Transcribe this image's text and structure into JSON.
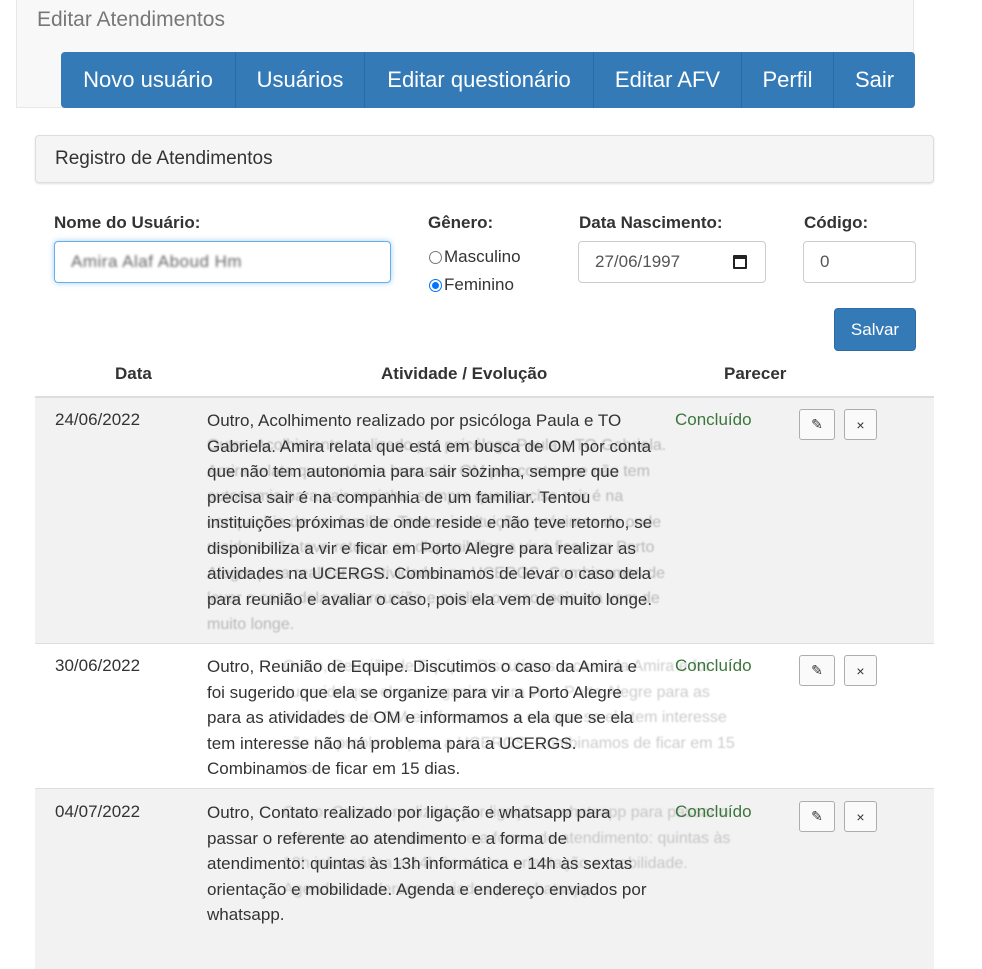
{
  "app": {
    "title": "Editar Atendimentos"
  },
  "navbar": {
    "items": [
      {
        "label": "Novo usuário"
      },
      {
        "label": "Usuários"
      },
      {
        "label": "Editar questionário"
      },
      {
        "label": "Editar AFV"
      },
      {
        "label": "Perfil"
      },
      {
        "label": "Sair"
      }
    ]
  },
  "section": {
    "title": "Registro de Atendimentos"
  },
  "form": {
    "name_label": "Nome do Usuário:",
    "name_value": "Amira Alaf Aboud Hm",
    "gender_label": "Gênero:",
    "gender_options": [
      {
        "label": "Masculino",
        "checked": false
      },
      {
        "label": "Feminino",
        "checked": true
      }
    ],
    "birth_label": "Data Nascimento:",
    "birth_value": "27/06/1997",
    "code_label": "Código:",
    "code_value": "0",
    "save_label": "Salvar"
  },
  "table": {
    "headers": {
      "date": "Data",
      "activity": "Atividade / Evolução",
      "status": "Parecer"
    },
    "rows": [
      {
        "date": "24/06/2022",
        "text": "Outro, Acolhimento realizado por psicóloga Paula e TO Gabriela. Amira relata que está em busca de OM por conta que não tem autonomia para sair sozinha, sempre que precisa sair é na companhia de um familiar. Tentou instituições próximas de onde reside e não teve retorno, se disponibiliza a vir e ficar em Porto Alegre para realizar as atividades na UCERGS. Combinamos de levar o caso dela para reunião e avaliar o caso, pois ela vem de muito longe.",
        "status": "Concluído",
        "edit_icon": "✎",
        "delete_icon": "×"
      },
      {
        "date": "30/06/2022",
        "text": "Outro, Reunião de Equipe. Discutimos o caso da Amira e foi sugerido que ela se organize para vir a Porto Alegre para as atividades de OM e informamos a ela que se ela tem interesse não há problema para a UCERGS. Combinamos de ficar em 15 dias.",
        "status": "Concluído",
        "edit_icon": "✎",
        "delete_icon": "×"
      },
      {
        "date": "04/07/2022",
        "text": "Outro, Contato realizado por ligação e whatsapp para passar o referente ao atendimento e a forma de atendimento: quintas às 13h informática e 14h às sextas orientação e mobilidade. Agenda e endereço enviados por whatsapp.",
        "status": "Concluído",
        "edit_icon": "✎",
        "delete_icon": "×"
      }
    ]
  },
  "colors": {
    "primary": "#337ab7",
    "success_text": "#3c763d",
    "stripe": "#f2f2f2"
  }
}
